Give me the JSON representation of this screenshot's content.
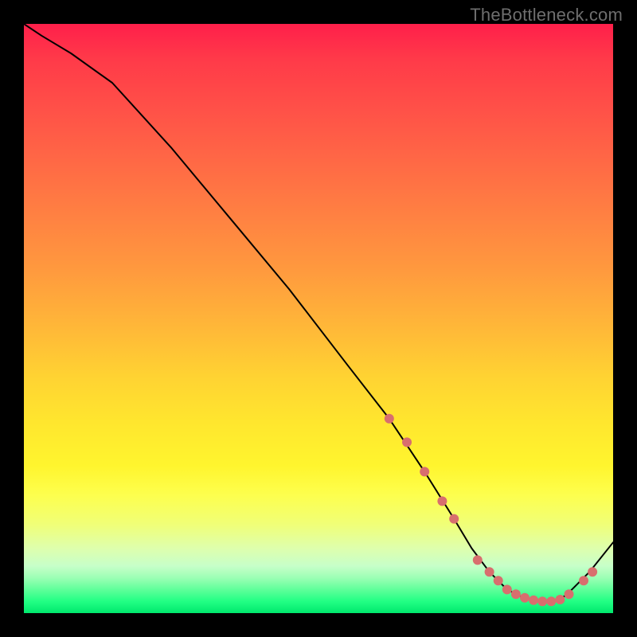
{
  "watermark": "TheBottleneck.com",
  "chart_data": {
    "type": "line",
    "title": "",
    "xlabel": "",
    "ylabel": "",
    "xlim": [
      0,
      100
    ],
    "ylim": [
      0,
      100
    ],
    "grid": false,
    "legend": false,
    "series": [
      {
        "name": "curve",
        "x": [
          0,
          3,
          8,
          15,
          25,
          35,
          45,
          55,
          62,
          68,
          73,
          76,
          79,
          82,
          85,
          88,
          90,
          92,
          96,
          100
        ],
        "y": [
          100,
          98,
          95,
          90,
          79,
          67,
          55,
          42,
          33,
          24,
          16,
          11,
          7,
          4,
          2.5,
          2,
          2,
          3,
          7,
          12
        ]
      }
    ],
    "markers": {
      "name": "highlight-points",
      "color": "#d86e6e",
      "points": [
        {
          "x": 62,
          "y": 33
        },
        {
          "x": 65,
          "y": 29
        },
        {
          "x": 68,
          "y": 24
        },
        {
          "x": 71,
          "y": 19
        },
        {
          "x": 73,
          "y": 16
        },
        {
          "x": 77,
          "y": 9
        },
        {
          "x": 79,
          "y": 7
        },
        {
          "x": 80.5,
          "y": 5.5
        },
        {
          "x": 82,
          "y": 4
        },
        {
          "x": 83.5,
          "y": 3.2
        },
        {
          "x": 85,
          "y": 2.6
        },
        {
          "x": 86.5,
          "y": 2.2
        },
        {
          "x": 88,
          "y": 2
        },
        {
          "x": 89.5,
          "y": 2
        },
        {
          "x": 91,
          "y": 2.3
        },
        {
          "x": 92.5,
          "y": 3.2
        },
        {
          "x": 95,
          "y": 5.5
        },
        {
          "x": 96.5,
          "y": 7
        }
      ]
    },
    "background_gradient": {
      "top": "#ff1f4a",
      "mid": "#ffe72e",
      "bottom": "#00e86d"
    }
  }
}
